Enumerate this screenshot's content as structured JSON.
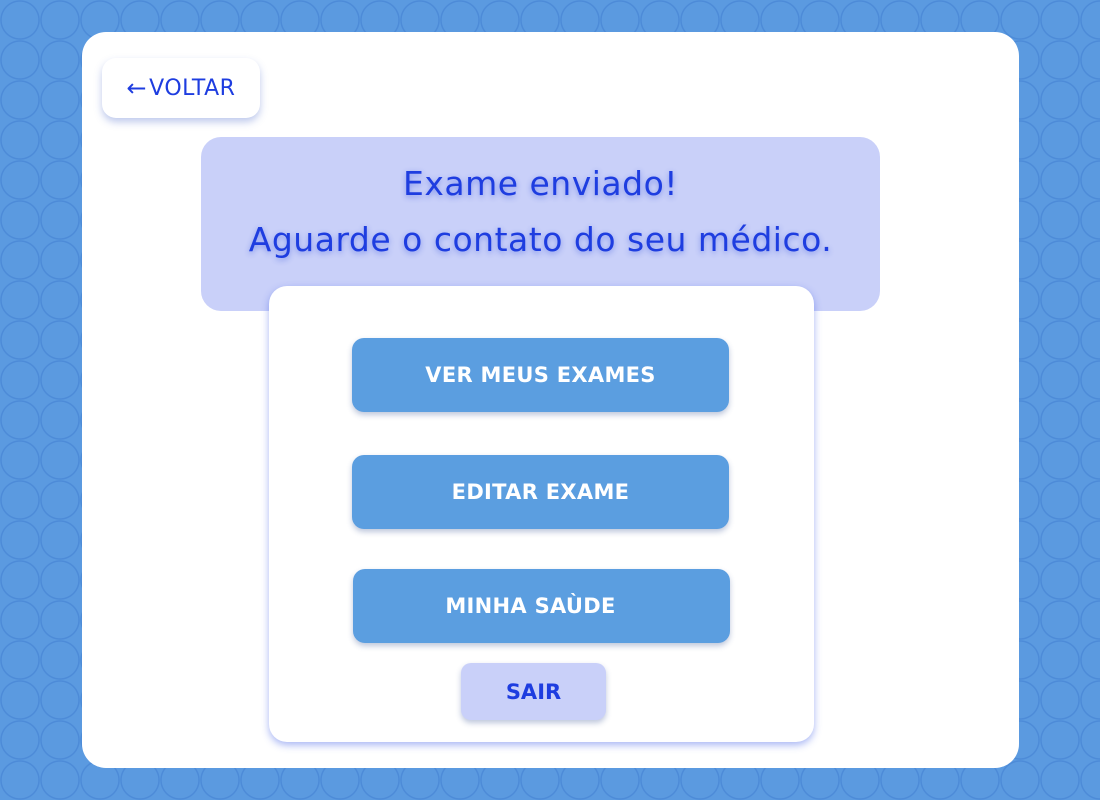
{
  "colors": {
    "page_background": "#5b9ae0",
    "card_background": "#ffffff",
    "accent_text": "#1e3de0",
    "banner_background": "#c9d0f9",
    "primary_button": "#5b9ee0",
    "primary_button_text": "#ffffff"
  },
  "nav": {
    "back_icon": "arrow-left-icon",
    "back_arrow": "←",
    "back_label": "VOLTAR"
  },
  "banner": {
    "line1": "Exame enviado!",
    "line2": "Aguarde o contato do seu médico."
  },
  "menu": {
    "items": [
      {
        "label": "VER MEUS EXAMES"
      },
      {
        "label": "EDITAR EXAME"
      },
      {
        "label": "MINHA SAÙDE"
      }
    ],
    "exit_label": "SAIR"
  }
}
